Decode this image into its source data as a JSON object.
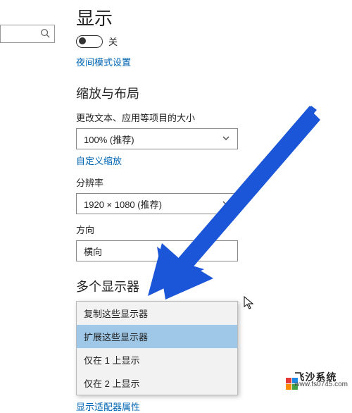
{
  "page_title": "显示",
  "toggle": {
    "state_label": "关"
  },
  "night_mode_link": "夜间模式设置",
  "scale_section": {
    "header": "缩放与布局",
    "text_size_label": "更改文本、应用等项目的大小",
    "text_size_value": "100% (推荐)",
    "custom_scale_link": "自定义缩放",
    "resolution_label": "分辨率",
    "resolution_value": "1920 × 1080 (推荐)",
    "orientation_label": "方向",
    "orientation_value": "横向"
  },
  "multi_section": {
    "header": "多个显示器",
    "options": [
      "复制这些显示器",
      "扩展这些显示器",
      "仅在 1 上显示",
      "仅在 2 上显示"
    ],
    "selected_index": 1,
    "adapter_link": "显示适配器属性"
  },
  "watermark": {
    "brand": "飞沙系统",
    "url": "www.fs0745.com"
  },
  "colors": {
    "link": "#0066b4",
    "dropdown_selected": "#9fc8e8",
    "arrow": "#1b56d8",
    "wm_colors": [
      "#e53935",
      "#1e88e5",
      "#43a047",
      "#fb8c00"
    ]
  }
}
